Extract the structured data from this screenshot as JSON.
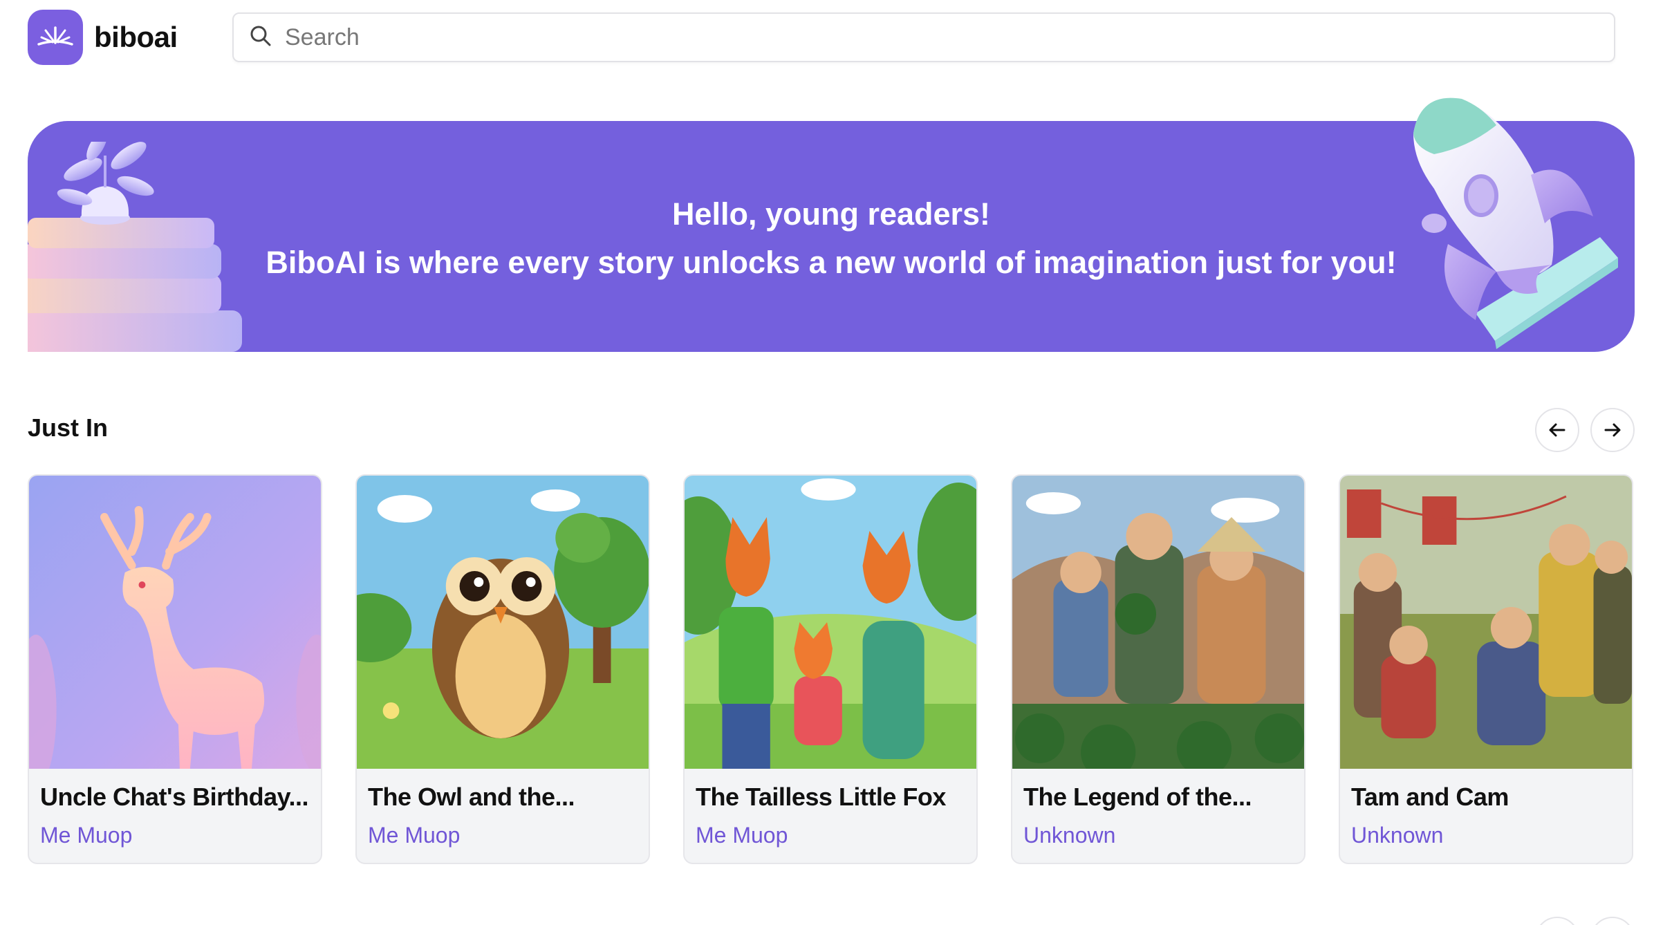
{
  "app": {
    "name": "biboai"
  },
  "search": {
    "placeholder": "Search"
  },
  "banner": {
    "line1": "Hello, young readers!",
    "line2": "BiboAI is where every story unlocks a new world of imagination just for you!"
  },
  "section": {
    "title": "Just In",
    "prev_icon": "arrow-left-icon",
    "next_icon": "arrow-right-icon"
  },
  "books": [
    {
      "title": "Uncle Chat's Birthday...",
      "author": "Me Muop"
    },
    {
      "title": "The Owl and the...",
      "author": "Me Muop"
    },
    {
      "title": "The Tailless Little Fox",
      "author": "Me Muop"
    },
    {
      "title": "The Legend of the...",
      "author": "Unknown"
    },
    {
      "title": "Tam and Cam",
      "author": "Unknown"
    }
  ],
  "colors": {
    "brand": "#7460dd",
    "author": "#7056d6",
    "card_bg": "#f3f4f6"
  }
}
